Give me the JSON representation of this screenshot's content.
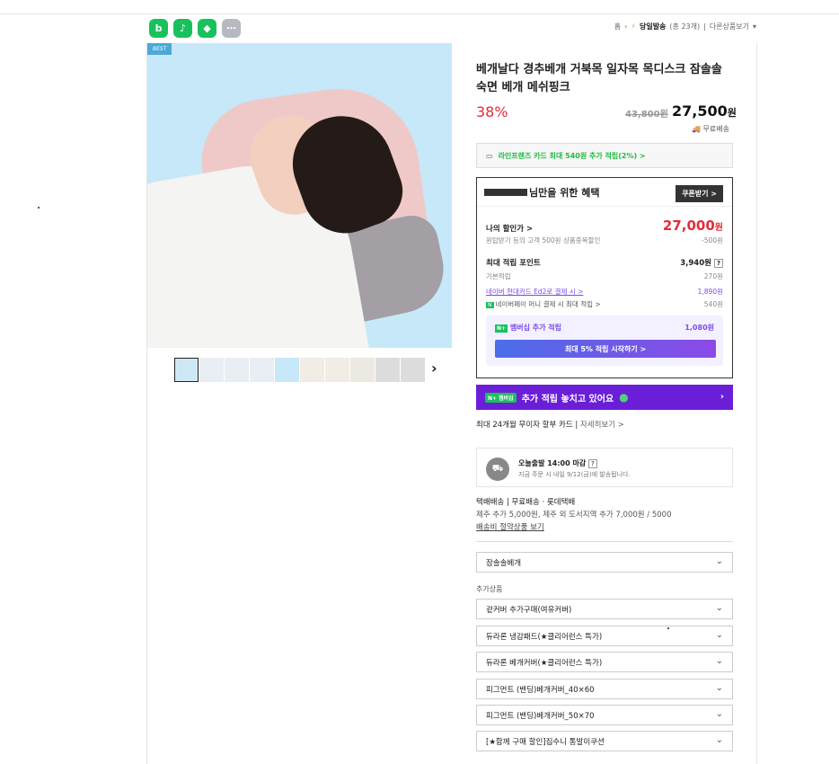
{
  "share": [
    {
      "icon": "blog-icon",
      "glyph": "b",
      "color": "#19c15c"
    },
    {
      "icon": "tiktok-icon",
      "glyph": "♪",
      "color": "#19c15c"
    },
    {
      "icon": "bookmark-icon",
      "glyph": "◆",
      "color": "#19c15c"
    },
    {
      "icon": "more-icon",
      "glyph": "⋯",
      "color": "#b6b9bf"
    }
  ],
  "topnav": {
    "home": "홈",
    "sameday": "당일발송",
    "count": "(총 23개)",
    "other": "다른상품보기"
  },
  "gallery": {
    "badge": "BEST"
  },
  "product": {
    "title": "베개날다 경추베개 거북목 일자목 목디스크 잠솔솔 숙면 베개 메쉬핑크",
    "discount": "38%",
    "original_price": "43,800원",
    "price": "27,500",
    "price_unit": "원",
    "shipping": "무료배송"
  },
  "card_promo": "라인프렌즈 카드 최대 540원 추가 적립(2%) >",
  "benefit": {
    "heading": "님만을 위한 혜택",
    "coupon_button": "쿠폰받기 >",
    "my_discount_label": "나의 할인가 >",
    "my_discount_price": "27,000",
    "my_discount_unit": "원",
    "my_discount_sub": "원탑받기 등의 고객 500원 상품중복할인",
    "my_discount_diff": "-500원",
    "points_label": "최대 적립 포인트",
    "points_value": "3,940원",
    "points_help": "?",
    "basic_label": "기본적립",
    "basic_value": "270원",
    "card_label": "네이버 현대카드 Ed2로 결제 시 >",
    "card_value": "1,890원",
    "pay_label": "네이버페이 머니 결제 시 최대 적립 >",
    "pay_value": "540원",
    "member_label": "멤버십 추가 적립",
    "member_value": "1,080원",
    "member_button": "최대 5% 적립 시작하기 >"
  },
  "banner": {
    "badge": "멤버십",
    "text": "추가 적립 놓치고 있어요"
  },
  "installment": {
    "text": "최대 24개월 무이자 할부 카드",
    "link": "자세히보기 >"
  },
  "delivery": {
    "line1": "오늘출발 14:00 마감",
    "help": "?",
    "line2": "지금 주문 시 내일 9/12(금)에 발송됩니다."
  },
  "shipping_info": {
    "line1": "택배배송 | 무료배송 · 롯데택배",
    "line2": "제주 추가 5,000원, 제주 외 도서지역 추가 7,000원 / 5000",
    "line3": "배송비 절약상품 보기"
  },
  "option_main": "잠솔솔베개",
  "add_label": "추가상품",
  "add_options": [
    "겉커버 추가구매(여유커버)",
    "듀라론 냉감패드(★클리어런스 특가)",
    "듀라론 베개커버(★클리어런스 특가)",
    "피그먼트 (밴딩)베개커버_40×60",
    "피그먼트 (밴딩)베개커버_50×70",
    "[★함께 구매 할인]집수니 통발이쿠션"
  ]
}
